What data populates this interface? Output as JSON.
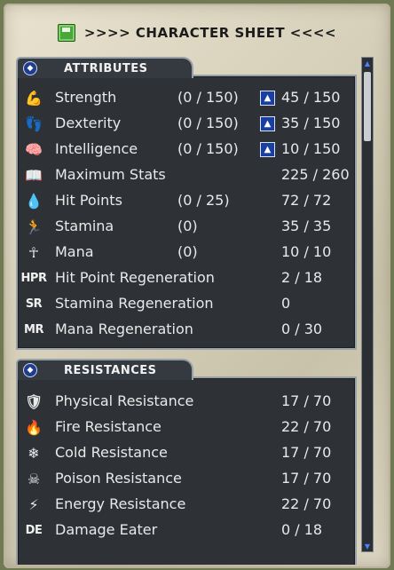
{
  "header": {
    "title": ">>>> CHARACTER SHEET <<<<"
  },
  "attributes": {
    "title": "ATTRIBUTES",
    "rows": [
      {
        "icon": "strength-arm-icon",
        "glyph": "💪",
        "label": "Strength",
        "cap": "(0 / 150)",
        "value": "45 / 150",
        "up": true
      },
      {
        "icon": "dexterity-icon",
        "glyph": "👣",
        "label": "Dexterity",
        "cap": "(0 / 150)",
        "value": "35 / 150",
        "up": true
      },
      {
        "icon": "brain-icon",
        "glyph": "🧠",
        "label": "Intelligence",
        "cap": "(0 / 150)",
        "value": "10 / 150",
        "up": true
      },
      {
        "icon": "book-icon",
        "glyph": "📖",
        "label": "Maximum Stats",
        "cap": "",
        "value": "225 / 260",
        "up": false
      },
      {
        "icon": "blood-drop-icon",
        "glyph": "💧",
        "label": "Hit Points",
        "cap": "(0 / 25)",
        "value": "72 / 72",
        "up": false
      },
      {
        "icon": "running-man-icon",
        "glyph": "🏃",
        "label": "Stamina",
        "cap": "(0)",
        "value": "35 / 35",
        "up": false
      },
      {
        "icon": "ankh-icon",
        "glyph": "☥",
        "label": "Mana",
        "cap": "(0)",
        "value": "10 / 10",
        "up": false
      },
      {
        "icon": "hpr-text-icon",
        "text": "HPR",
        "label": "Hit Point Regeneration",
        "cap": "",
        "value": "2 / 18",
        "up": false
      },
      {
        "icon": "sr-text-icon",
        "text": "SR",
        "label": "Stamina Regeneration",
        "cap": "",
        "value": "0",
        "up": false
      },
      {
        "icon": "mr-text-icon",
        "text": "MR",
        "label": "Mana Regeneration",
        "cap": "",
        "value": "0 / 30",
        "up": false
      }
    ]
  },
  "resistances": {
    "title": "RESISTANCES",
    "rows": [
      {
        "icon": "shield-icon",
        "glyph": "🛡",
        "label": "Physical Resistance",
        "value": "17 / 70"
      },
      {
        "icon": "fire-icon",
        "glyph": "🔥",
        "label": "Fire Resistance",
        "value": "22 / 70"
      },
      {
        "icon": "snowflake-icon",
        "glyph": "❄",
        "label": "Cold Resistance",
        "value": "17 / 70"
      },
      {
        "icon": "skull-icon",
        "glyph": "☠",
        "label": "Poison Resistance",
        "value": "17 / 70"
      },
      {
        "icon": "lightning-icon",
        "glyph": "⚡",
        "label": "Energy Resistance",
        "value": "22 / 70"
      },
      {
        "icon": "de-text-icon",
        "text": "DE",
        "label": "Damage Eater",
        "value": "0 / 18"
      }
    ]
  },
  "colors": {
    "panel": "#2e3237",
    "border": "#98a0a8",
    "text": "#e9e9e9",
    "upgrade": "#1b3fa0"
  }
}
